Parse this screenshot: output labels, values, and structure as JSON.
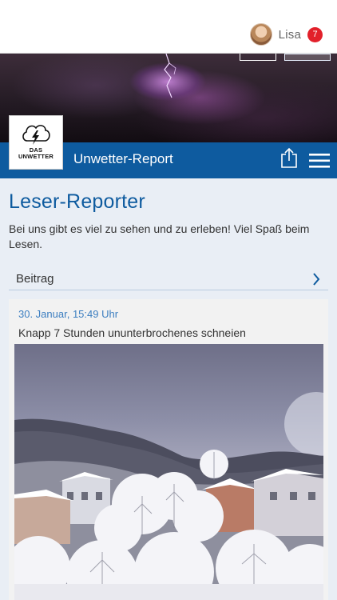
{
  "user": {
    "name": "Lisa",
    "notification_count": "7"
  },
  "header": {
    "brand_line1": "DAS",
    "brand_line2": "UNWETTER",
    "title": "Unwetter-Report"
  },
  "main": {
    "heading": "Leser-Reporter",
    "intro": "Bei uns gibt es viel zu sehen und zu erleben! Viel Spaß beim Lesen.",
    "beitrag_label": "Beitrag"
  },
  "post": {
    "date": "30. Januar, 15:49 Uhr",
    "title": "Knapp 7 Stunden ununterbrochenes schneien"
  },
  "icons": {
    "share": "share-icon",
    "menu": "hamburger-menu-icon",
    "chevron": "chevron-right-icon",
    "brand": "cloud-lightning-icon"
  },
  "colors": {
    "primary_blue": "#0e5b9f",
    "link_blue": "#3c7ec0",
    "badge_red": "#e2202a"
  }
}
